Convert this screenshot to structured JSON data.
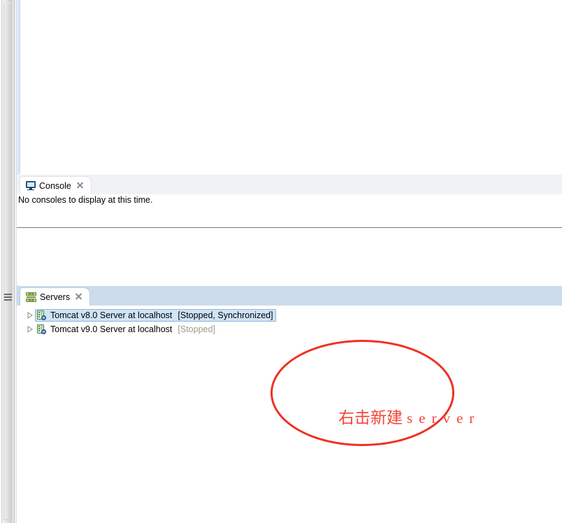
{
  "window": {
    "left_rail": {
      "fastview_menu_icon": "hamburger-menu-icon"
    }
  },
  "editor": {
    "content": ""
  },
  "console_view": {
    "tab": {
      "icon": "console-icon",
      "label": "Console",
      "close_icon": "close-icon"
    },
    "message": "No consoles to display at this time."
  },
  "servers_view": {
    "tab": {
      "icon": "servers-icon",
      "label": "Servers",
      "close_icon": "close-icon"
    },
    "rows": [
      {
        "expand_icon": "chevron-right-icon",
        "server_icon": "server-icon",
        "name": "Tomcat v8.0 Server at localhost",
        "status": "[Stopped, Synchronized]",
        "selected": true,
        "muted_status": false
      },
      {
        "expand_icon": "chevron-right-icon",
        "server_icon": "server-icon",
        "name": "Tomcat v9.0 Server at localhost",
        "status": "[Stopped]",
        "selected": false,
        "muted_status": true
      }
    ]
  },
  "annotation": {
    "shape": "ellipse",
    "color": "#ee3124",
    "text_cjk": "右击新建",
    "text_latin": "server",
    "text_color": "#f2463a"
  }
}
